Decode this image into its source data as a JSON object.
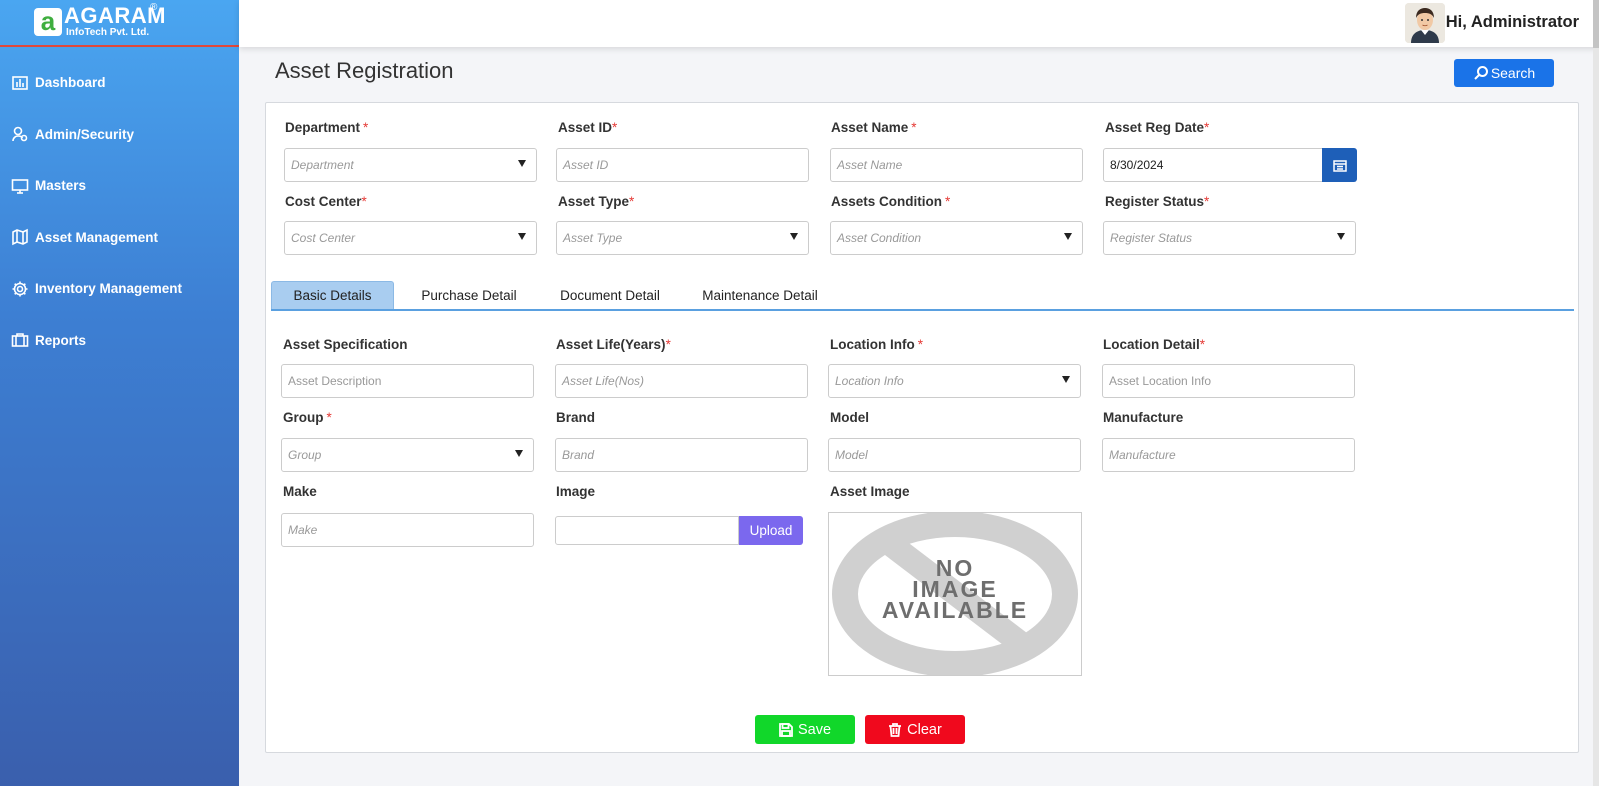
{
  "brand": {
    "name": "AGARAM",
    "sub": "InfoTech Pvt. Ltd.",
    "reg": "®",
    "mark": "a"
  },
  "sidebar": {
    "items": [
      {
        "label": "Dashboard",
        "icon": "bar-chart-icon"
      },
      {
        "label": "Admin/Security",
        "icon": "users-icon"
      },
      {
        "label": "Masters",
        "icon": "monitor-icon"
      },
      {
        "label": "Asset Management",
        "icon": "map-icon"
      },
      {
        "label": "Inventory Management",
        "icon": "gear-icon"
      },
      {
        "label": "Reports",
        "icon": "briefcase-icon"
      }
    ]
  },
  "header": {
    "greeting": "Hi, Administrator"
  },
  "page": {
    "title": "Asset Registration",
    "search_label": "Search"
  },
  "form": {
    "department": {
      "label": "Department",
      "placeholder": "Department"
    },
    "asset_id": {
      "label": "Asset ID",
      "placeholder": "Asset ID"
    },
    "asset_name": {
      "label": "Asset Name",
      "placeholder": "Asset Name"
    },
    "asset_reg_date": {
      "label": "Asset Reg Date",
      "value": "8/30/2024"
    },
    "cost_center": {
      "label": "Cost Center",
      "placeholder": "Cost Center"
    },
    "asset_type": {
      "label": "Asset Type",
      "placeholder": "Asset Type"
    },
    "assets_condition": {
      "label": "Assets Condition",
      "placeholder": "Asset Condition"
    },
    "register_status": {
      "label": "Register Status",
      "placeholder": "Register Status"
    }
  },
  "tabs": [
    "Basic Details",
    "Purchase Detail",
    "Document Detail",
    "Maintenance Detail"
  ],
  "details": {
    "asset_specification": {
      "label": "Asset Specification",
      "placeholder": "Asset Description"
    },
    "asset_life": {
      "label": "Asset Life(Years)",
      "placeholder": "Asset Life(Nos)"
    },
    "location_info": {
      "label": "Location Info",
      "placeholder": "Location Info"
    },
    "location_detail": {
      "label": "Location Detail",
      "placeholder": "Asset Location Info"
    },
    "group": {
      "label": "Group",
      "placeholder": "Group"
    },
    "brand": {
      "label": "Brand",
      "placeholder": "Brand"
    },
    "model": {
      "label": "Model",
      "placeholder": "Model"
    },
    "manufacture": {
      "label": "Manufacture",
      "placeholder": "Manufacture"
    },
    "make": {
      "label": "Make",
      "placeholder": "Make"
    },
    "image": {
      "label": "Image",
      "upload_label": "Upload"
    },
    "asset_image": {
      "label": "Asset Image",
      "no_image_lines": [
        "NO",
        "IMAGE",
        "AVAILABLE"
      ]
    }
  },
  "required_mark": "*",
  "actions": {
    "save": "Save",
    "clear": "Clear"
  },
  "colors": {
    "accent": "#1a73e8",
    "save": "#11d72a",
    "clear": "#f0091d",
    "upload": "#7b68ee",
    "required": "#e53935"
  }
}
